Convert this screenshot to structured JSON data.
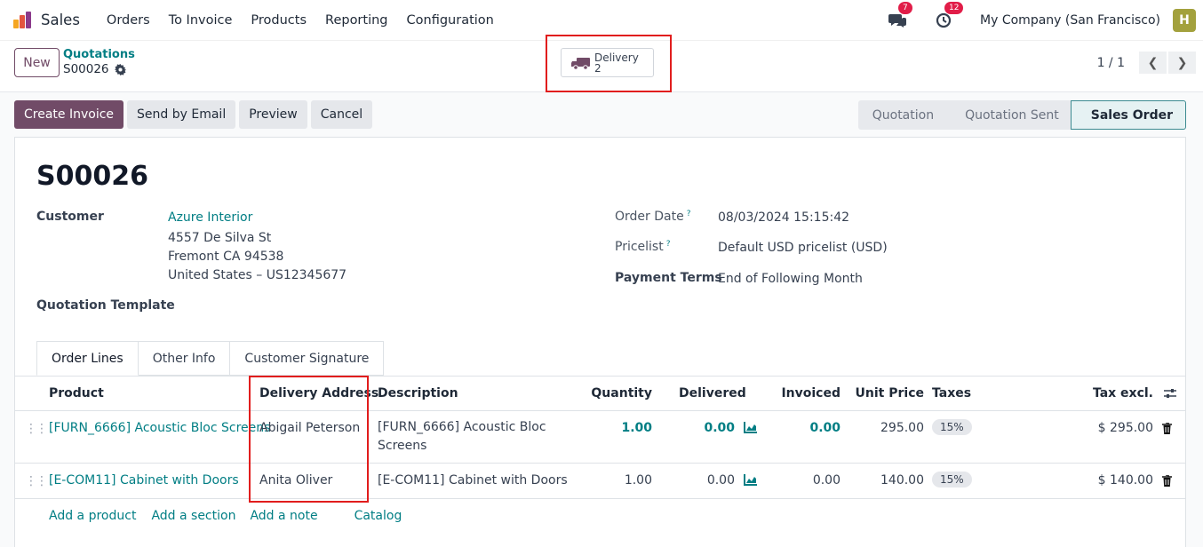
{
  "nav": {
    "app_name": "Sales",
    "menu": [
      "Orders",
      "To Invoice",
      "Products",
      "Reporting",
      "Configuration"
    ],
    "messages_count": "7",
    "activities_count": "12",
    "company": "My Company (San Francisco)",
    "avatar_initial": "H",
    "logo_colors": [
      "#f5a623",
      "#e3553f",
      "#8b3a8b"
    ]
  },
  "control": {
    "new_label": "New",
    "breadcrumb_parent": "Quotations",
    "breadcrumb_current": "S00026",
    "smart_button": {
      "label": "Delivery",
      "count": "2"
    },
    "pager": "1 / 1"
  },
  "actions": [
    "Create Invoice",
    "Send by Email",
    "Preview",
    "Cancel"
  ],
  "status": [
    "Quotation",
    "Quotation Sent",
    "Sales Order"
  ],
  "form": {
    "title": "S00026",
    "customer_label": "Customer",
    "customer_name": "Azure Interior",
    "address_lines": [
      "4557 De Silva St",
      "Fremont CA 94538",
      "United States – US12345677"
    ],
    "quotation_template_label": "Quotation Template",
    "order_date_label": "Order Date",
    "order_date": "08/03/2024 15:15:42",
    "pricelist_label": "Pricelist",
    "pricelist": "Default USD pricelist (USD)",
    "payment_terms_label": "Payment Terms",
    "payment_terms": "End of Following Month",
    "help_mark": "?"
  },
  "tabs": [
    "Order Lines",
    "Other Info",
    "Customer Signature"
  ],
  "order_lines": {
    "headers": {
      "product": "Product",
      "delivery_address": "Delivery Address",
      "description": "Description",
      "quantity": "Quantity",
      "delivered": "Delivered",
      "invoiced": "Invoiced",
      "unit_price": "Unit Price",
      "taxes": "Taxes",
      "tax_excl": "Tax excl."
    },
    "rows": [
      {
        "product": "[FURN_6666] Acoustic Bloc Screens",
        "delivery_address": "Abigail Peterson",
        "description_1": "[FURN_6666] Acoustic Bloc",
        "description_2": "Screens",
        "quantity": "1.00",
        "delivered": "0.00",
        "invoiced": "0.00",
        "unit_price": "295.00",
        "tax": "15%",
        "subtotal": "$ 295.00"
      },
      {
        "product": "[E-COM11] Cabinet with Doors",
        "delivery_address": "Anita Oliver",
        "description_1": "[E-COM11] Cabinet with Doors",
        "description_2": "",
        "quantity": "1.00",
        "delivered": "0.00",
        "invoiced": "0.00",
        "unit_price": "140.00",
        "tax": "15%",
        "subtotal": "$ 140.00"
      }
    ],
    "add_links": [
      "Add a product",
      "Add a section",
      "Add a note",
      "Catalog"
    ]
  }
}
